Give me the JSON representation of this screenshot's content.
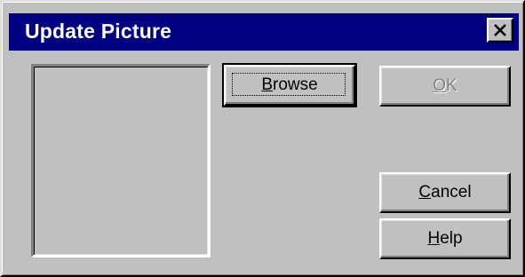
{
  "window": {
    "title": "Update Picture",
    "close_icon": "close-x-icon"
  },
  "buttons": {
    "browse": {
      "access": "B",
      "rest": "rowse",
      "state": "default-focused"
    },
    "ok": {
      "access": "O",
      "rest": "K",
      "state": "disabled"
    },
    "cancel": {
      "access": "C",
      "rest": "ancel",
      "state": "normal"
    },
    "help": {
      "access": "H",
      "rest": "elp",
      "state": "normal"
    }
  },
  "colors": {
    "titlebar": "#000080",
    "face": "#c0c0c0",
    "disabled_text": "#808080"
  }
}
